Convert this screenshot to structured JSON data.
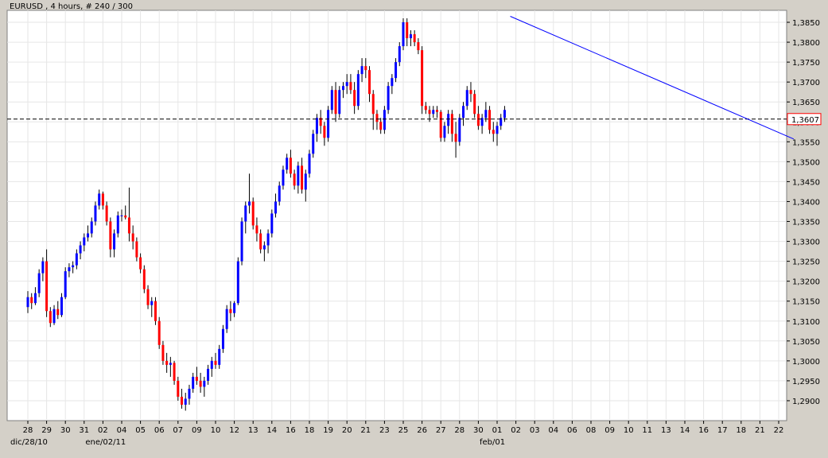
{
  "chart_title": "EURUSD , 4 hours, # 240 / 300",
  "price_box_label": "1,3607",
  "colors": {
    "up": "#0000ff",
    "down": "#ff0000",
    "wick": "#000000",
    "trendline": "#0000ff",
    "grid": "#e6e6e6",
    "background": "#ffffff",
    "price_box_border": "#ff0000"
  },
  "chart_data": {
    "type": "candlestick",
    "title": "EURUSD , 4 hours, # 240 / 300",
    "symbol": "EURUSD",
    "timeframe": "4 hours",
    "bars_label": "# 240 / 300",
    "ylim": [
      1.285,
      1.388
    ],
    "y_ticks": [
      "1,2900",
      "1,2950",
      "1,3000",
      "1,3050",
      "1,3100",
      "1,3150",
      "1,3200",
      "1,3250",
      "1,3300",
      "1,3350",
      "1,3400",
      "1,3450",
      "1,3500",
      "1,3550",
      "1,3600",
      "1,3650",
      "1,3700",
      "1,3750",
      "1,3800",
      "1,3850"
    ],
    "y_tick_values": [
      1.29,
      1.295,
      1.3,
      1.305,
      1.31,
      1.315,
      1.32,
      1.325,
      1.33,
      1.335,
      1.34,
      1.345,
      1.35,
      1.355,
      1.36,
      1.365,
      1.37,
      1.375,
      1.38,
      1.385
    ],
    "x_day_labels": [
      "28",
      "29",
      "30",
      "31",
      "02",
      "04",
      "05",
      "06",
      "07",
      "09",
      "10",
      "12",
      "13",
      "14",
      "16",
      "18",
      "19",
      "20",
      "21",
      "23",
      "25",
      "26",
      "27",
      "28",
      "30",
      "01",
      "02",
      "03",
      "04",
      "06",
      "08",
      "09",
      "10",
      "11",
      "13",
      "14",
      "16",
      "17",
      "18",
      "21",
      "22"
    ],
    "x_month_labels": [
      {
        "label": "dic/28/10",
        "at_day": 0
      },
      {
        "label": "ene/02/11",
        "at_day": 4
      },
      {
        "label": "feb/01",
        "at_day": 25
      }
    ],
    "current_price": 1.3607,
    "grid": true,
    "trendline": {
      "from": {
        "day": 25.7,
        "price": 1.3865
      },
      "to": {
        "day": 40.8,
        "price": 1.3557
      }
    },
    "candles": [
      [
        0.0,
        1.3135,
        1.3175,
        1.312,
        1.316
      ],
      [
        0.2,
        1.316,
        1.317,
        1.313,
        1.3145
      ],
      [
        0.4,
        1.3145,
        1.3185,
        1.314,
        1.317
      ],
      [
        0.6,
        1.317,
        1.323,
        1.316,
        1.322
      ],
      [
        0.8,
        1.322,
        1.326,
        1.32,
        1.325
      ],
      [
        1.0,
        1.325,
        1.328,
        1.311,
        1.3125
      ],
      [
        1.2,
        1.3125,
        1.3135,
        1.3085,
        1.3095
      ],
      [
        1.4,
        1.3095,
        1.314,
        1.309,
        1.313
      ],
      [
        1.6,
        1.313,
        1.315,
        1.3105,
        1.3115
      ],
      [
        1.8,
        1.3115,
        1.317,
        1.311,
        1.316
      ],
      [
        2.0,
        1.316,
        1.3235,
        1.3155,
        1.3225
      ],
      [
        2.2,
        1.3225,
        1.3245,
        1.321,
        1.3235
      ],
      [
        2.4,
        1.3235,
        1.325,
        1.322,
        1.324
      ],
      [
        2.6,
        1.324,
        1.328,
        1.323,
        1.327
      ],
      [
        2.8,
        1.327,
        1.33,
        1.3255,
        1.329
      ],
      [
        3.0,
        1.329,
        1.332,
        1.3275,
        1.331
      ],
      [
        3.2,
        1.331,
        1.334,
        1.33,
        1.332
      ],
      [
        3.4,
        1.332,
        1.336,
        1.331,
        1.335
      ],
      [
        3.6,
        1.335,
        1.34,
        1.334,
        1.339
      ],
      [
        3.8,
        1.339,
        1.343,
        1.338,
        1.342
      ],
      [
        4.0,
        1.342,
        1.3425,
        1.338,
        1.339
      ],
      [
        4.2,
        1.339,
        1.34,
        1.334,
        1.335
      ],
      [
        4.4,
        1.335,
        1.336,
        1.326,
        1.328
      ],
      [
        4.6,
        1.328,
        1.333,
        1.326,
        1.332
      ],
      [
        4.8,
        1.332,
        1.3375,
        1.331,
        1.3365
      ],
      [
        5.0,
        1.3365,
        1.338,
        1.335,
        1.3365
      ],
      [
        5.2,
        1.3365,
        1.339,
        1.3355,
        1.336
      ],
      [
        5.4,
        1.336,
        1.3435,
        1.33,
        1.332
      ],
      [
        5.6,
        1.332,
        1.334,
        1.328,
        1.33
      ],
      [
        5.8,
        1.33,
        1.331,
        1.325,
        1.326
      ],
      [
        6.0,
        1.326,
        1.327,
        1.322,
        1.323
      ],
      [
        6.2,
        1.323,
        1.324,
        1.317,
        1.318
      ],
      [
        6.4,
        1.318,
        1.319,
        1.313,
        1.314
      ],
      [
        6.6,
        1.314,
        1.316,
        1.311,
        1.315
      ],
      [
        6.8,
        1.315,
        1.316,
        1.309,
        1.31
      ],
      [
        7.0,
        1.31,
        1.311,
        1.303,
        1.304
      ],
      [
        7.2,
        1.304,
        1.305,
        1.299,
        1.3
      ],
      [
        7.4,
        1.3,
        1.302,
        1.297,
        1.299
      ],
      [
        7.6,
        1.299,
        1.301,
        1.296,
        1.2995
      ],
      [
        7.8,
        1.2995,
        1.3,
        1.294,
        1.295
      ],
      [
        8.0,
        1.295,
        1.296,
        1.29,
        1.291
      ],
      [
        8.2,
        1.291,
        1.293,
        1.288,
        1.289
      ],
      [
        8.4,
        1.289,
        1.292,
        1.2875,
        1.2905
      ],
      [
        8.6,
        1.2905,
        1.294,
        1.289,
        1.293
      ],
      [
        8.8,
        1.293,
        1.297,
        1.292,
        1.296
      ],
      [
        9.0,
        1.296,
        1.2985,
        1.294,
        1.295
      ],
      [
        9.2,
        1.295,
        1.297,
        1.292,
        1.2935
      ],
      [
        9.4,
        1.2935,
        1.296,
        1.291,
        1.295
      ],
      [
        9.6,
        1.295,
        1.299,
        1.294,
        1.298
      ],
      [
        9.8,
        1.298,
        1.301,
        1.296,
        1.3
      ],
      [
        10.0,
        1.3,
        1.302,
        1.298,
        1.299
      ],
      [
        10.2,
        1.299,
        1.304,
        1.298,
        1.303
      ],
      [
        10.4,
        1.303,
        1.309,
        1.302,
        1.308
      ],
      [
        10.6,
        1.308,
        1.314,
        1.307,
        1.313
      ],
      [
        10.8,
        1.313,
        1.315,
        1.31,
        1.312
      ],
      [
        11.0,
        1.312,
        1.315,
        1.311,
        1.3145
      ],
      [
        11.2,
        1.3145,
        1.326,
        1.314,
        1.325
      ],
      [
        11.4,
        1.325,
        1.336,
        1.324,
        1.335
      ],
      [
        11.6,
        1.335,
        1.34,
        1.332,
        1.339
      ],
      [
        11.8,
        1.339,
        1.347,
        1.337,
        1.34
      ],
      [
        12.0,
        1.34,
        1.341,
        1.333,
        1.334
      ],
      [
        12.2,
        1.334,
        1.336,
        1.33,
        1.332
      ],
      [
        12.4,
        1.332,
        1.333,
        1.327,
        1.328
      ],
      [
        12.6,
        1.328,
        1.33,
        1.325,
        1.329
      ],
      [
        12.8,
        1.329,
        1.333,
        1.327,
        1.332
      ],
      [
        13.0,
        1.332,
        1.338,
        1.331,
        1.337
      ],
      [
        13.2,
        1.337,
        1.342,
        1.336,
        1.34
      ],
      [
        13.4,
        1.34,
        1.345,
        1.339,
        1.344
      ],
      [
        13.6,
        1.344,
        1.349,
        1.343,
        1.348
      ],
      [
        13.8,
        1.348,
        1.352,
        1.347,
        1.351
      ],
      [
        14.0,
        1.351,
        1.353,
        1.346,
        1.347
      ],
      [
        14.2,
        1.347,
        1.348,
        1.343,
        1.344
      ],
      [
        14.4,
        1.344,
        1.35,
        1.342,
        1.349
      ],
      [
        14.6,
        1.349,
        1.351,
        1.342,
        1.343
      ],
      [
        14.8,
        1.343,
        1.348,
        1.34,
        1.347
      ],
      [
        15.0,
        1.347,
        1.353,
        1.346,
        1.352
      ],
      [
        15.2,
        1.352,
        1.358,
        1.351,
        1.357
      ],
      [
        15.4,
        1.357,
        1.362,
        1.355,
        1.361
      ],
      [
        15.6,
        1.361,
        1.363,
        1.357,
        1.359
      ],
      [
        15.8,
        1.359,
        1.36,
        1.354,
        1.356
      ],
      [
        16.0,
        1.356,
        1.364,
        1.355,
        1.363
      ],
      [
        16.2,
        1.363,
        1.369,
        1.362,
        1.368
      ],
      [
        16.4,
        1.368,
        1.37,
        1.36,
        1.362
      ],
      [
        16.6,
        1.362,
        1.369,
        1.361,
        1.368
      ],
      [
        16.8,
        1.368,
        1.37,
        1.366,
        1.369
      ],
      [
        17.0,
        1.369,
        1.372,
        1.367,
        1.37
      ],
      [
        17.2,
        1.37,
        1.372,
        1.367,
        1.368
      ],
      [
        17.4,
        1.368,
        1.37,
        1.362,
        1.364
      ],
      [
        17.6,
        1.364,
        1.373,
        1.363,
        1.372
      ],
      [
        17.8,
        1.372,
        1.376,
        1.37,
        1.374
      ],
      [
        18.0,
        1.374,
        1.376,
        1.371,
        1.373
      ],
      [
        18.2,
        1.373,
        1.374,
        1.365,
        1.367
      ],
      [
        18.4,
        1.367,
        1.368,
        1.358,
        1.362
      ],
      [
        18.6,
        1.362,
        1.363,
        1.358,
        1.36
      ],
      [
        18.8,
        1.36,
        1.361,
        1.357,
        1.358
      ],
      [
        19.0,
        1.358,
        1.364,
        1.357,
        1.363
      ],
      [
        19.2,
        1.363,
        1.37,
        1.362,
        1.369
      ],
      [
        19.4,
        1.369,
        1.372,
        1.367,
        1.371
      ],
      [
        19.6,
        1.371,
        1.376,
        1.37,
        1.375
      ],
      [
        19.8,
        1.375,
        1.38,
        1.374,
        1.379
      ],
      [
        20.0,
        1.379,
        1.386,
        1.378,
        1.385
      ],
      [
        20.2,
        1.385,
        1.386,
        1.379,
        1.381
      ],
      [
        20.4,
        1.381,
        1.383,
        1.379,
        1.382
      ],
      [
        20.6,
        1.382,
        1.383,
        1.379,
        1.38
      ],
      [
        20.8,
        1.38,
        1.381,
        1.377,
        1.378
      ],
      [
        21.0,
        1.378,
        1.379,
        1.362,
        1.364
      ],
      [
        21.2,
        1.364,
        1.365,
        1.362,
        1.363
      ],
      [
        21.4,
        1.363,
        1.364,
        1.36,
        1.362
      ],
      [
        21.6,
        1.362,
        1.364,
        1.361,
        1.363
      ],
      [
        21.8,
        1.363,
        1.364,
        1.361,
        1.3625
      ],
      [
        22.0,
        1.3625,
        1.363,
        1.355,
        1.356
      ],
      [
        22.2,
        1.356,
        1.36,
        1.355,
        1.359
      ],
      [
        22.4,
        1.359,
        1.363,
        1.357,
        1.362
      ],
      [
        22.6,
        1.362,
        1.363,
        1.355,
        1.357
      ],
      [
        22.8,
        1.357,
        1.36,
        1.351,
        1.355
      ],
      [
        23.0,
        1.355,
        1.362,
        1.354,
        1.361
      ],
      [
        23.2,
        1.361,
        1.365,
        1.359,
        1.364
      ],
      [
        23.4,
        1.364,
        1.369,
        1.363,
        1.368
      ],
      [
        23.6,
        1.368,
        1.37,
        1.365,
        1.367
      ],
      [
        23.8,
        1.367,
        1.368,
        1.361,
        1.362
      ],
      [
        24.0,
        1.362,
        1.364,
        1.358,
        1.359
      ],
      [
        24.2,
        1.359,
        1.362,
        1.357,
        1.361
      ],
      [
        24.4,
        1.361,
        1.365,
        1.36,
        1.363
      ],
      [
        24.6,
        1.363,
        1.364,
        1.357,
        1.358
      ],
      [
        24.8,
        1.358,
        1.36,
        1.355,
        1.357
      ],
      [
        25.0,
        1.357,
        1.36,
        1.354,
        1.359
      ],
      [
        25.2,
        1.359,
        1.362,
        1.358,
        1.361
      ],
      [
        25.4,
        1.361,
        1.364,
        1.36,
        1.363
      ]
    ]
  }
}
